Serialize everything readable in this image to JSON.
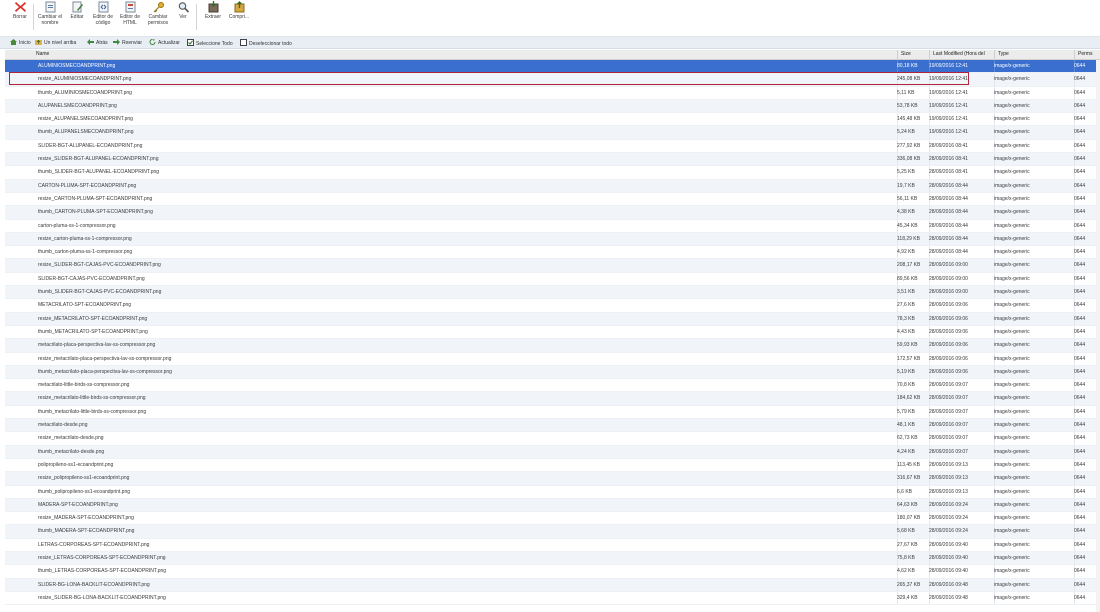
{
  "toolbar": {
    "items": [
      {
        "label": "Borrar",
        "icon": "delete-x-icon"
      },
      {
        "label": "Cambiar el nombre",
        "icon": "rename-icon"
      },
      {
        "label": "Editar",
        "icon": "edit-icon"
      },
      {
        "label": "Editor de código",
        "icon": "code-editor-icon"
      },
      {
        "label": "Editor de HTML",
        "icon": "html-editor-icon"
      },
      {
        "label": "Cambiar permisos",
        "icon": "key-icon"
      },
      {
        "label": "Ver",
        "icon": "magnifier-icon"
      },
      {
        "label": "Extraer",
        "icon": "extract-icon"
      },
      {
        "label": "Compri...",
        "icon": "compress-icon"
      }
    ]
  },
  "nav": {
    "items": [
      {
        "label": "Inicio",
        "icon": "home-icon"
      },
      {
        "label": "Un nivel arriba",
        "icon": "folder-up-icon"
      },
      {
        "label": "Atrás",
        "icon": "back-arrow-icon"
      },
      {
        "label": "Reenviar",
        "icon": "forward-arrow-icon"
      },
      {
        "label": "Actualizar",
        "icon": "refresh-icon"
      },
      {
        "label": "Seleccione Todo",
        "icon": "checkbox-checked-icon"
      },
      {
        "label": "Deseleccionar todo",
        "icon": "checkbox-empty-icon"
      }
    ]
  },
  "columns": {
    "name": "Name",
    "size": "Size",
    "modified": "Last Modified (Hora del",
    "type": "Type",
    "perms": "Perms"
  },
  "colors": {
    "selected_row": "#3a6fd0",
    "highlight_border": "#b0243a"
  },
  "files": [
    {
      "name": "ALUMINIOSMECOANDPRINT.png",
      "size": "80,18 KB",
      "modified": "19/09/2016 12:41",
      "type": "image/x-generic",
      "perms": "0644",
      "selected": true
    },
    {
      "name": "resize_ALUMINIOSMECOANDPRINT.png",
      "size": "245,08 KB",
      "modified": "19/09/2016 12:41",
      "type": "image/x-generic",
      "perms": "0644"
    },
    {
      "name": "thumb_ALUMINIOSMECOANDPRINT.png",
      "size": "5,11 KB",
      "modified": "19/09/2016 12:41",
      "type": "image/x-generic",
      "perms": "0644"
    },
    {
      "name": "ALUPANELSMECOANDPRINT.png",
      "size": "53,78 KB",
      "modified": "19/09/2016 12:41",
      "type": "image/x-generic",
      "perms": "0644"
    },
    {
      "name": "resize_ALUPANELSMECOANDPRINT.png",
      "size": "145,48 KB",
      "modified": "19/09/2016 12:41",
      "type": "image/x-generic",
      "perms": "0644"
    },
    {
      "name": "thumb_ALUPANELSMECOANDPRINT.png",
      "size": "5,24 KB",
      "modified": "19/09/2016 12:41",
      "type": "image/x-generic",
      "perms": "0644"
    },
    {
      "name": "SLIDER-BGT-ALUPANEL-ECOANDPRINT.png",
      "size": "277,92 KB",
      "modified": "28/09/2016 08:41",
      "type": "image/x-generic",
      "perms": "0644"
    },
    {
      "name": "resize_SLIDER-BGT-ALUPANEL-ECOANDPRINT.png",
      "size": "336,08 KB",
      "modified": "28/09/2016 08:41",
      "type": "image/x-generic",
      "perms": "0644"
    },
    {
      "name": "thumb_SLIDER-BGT-ALUPANEL-ECOANDPRINT.png",
      "size": "5,25 KB",
      "modified": "28/09/2016 08:41",
      "type": "image/x-generic",
      "perms": "0644"
    },
    {
      "name": "CARTON-PLUMA-SPT-ECOANDPRINT.png",
      "size": "19,7 KB",
      "modified": "28/09/2016 08:44",
      "type": "image/x-generic",
      "perms": "0644"
    },
    {
      "name": "resize_CARTON-PLUMA-SPT-ECOANDPRINT.png",
      "size": "56,11 KB",
      "modified": "28/09/2016 08:44",
      "type": "image/x-generic",
      "perms": "0644"
    },
    {
      "name": "thumb_CARTON-PLUMA-SPT-ECOANDPRINT.png",
      "size": "4,38 KB",
      "modified": "28/09/2016 08:44",
      "type": "image/x-generic",
      "perms": "0644"
    },
    {
      "name": "carton-pluma-ss-1-compressor.png",
      "size": "45,34 KB",
      "modified": "28/09/2016 08:44",
      "type": "image/x-generic",
      "perms": "0644"
    },
    {
      "name": "resize_carton-pluma-ss-1-compressor.png",
      "size": "118,29 KB",
      "modified": "28/09/2016 08:44",
      "type": "image/x-generic",
      "perms": "0644"
    },
    {
      "name": "thumb_carton-pluma-ss-1-compressor.png",
      "size": "4,92 KB",
      "modified": "28/09/2016 08:44",
      "type": "image/x-generic",
      "perms": "0644"
    },
    {
      "name": "resize_SLIDER-BGT-CAJAS-PVC-ECOANDPRINT.png",
      "size": "208,17 KB",
      "modified": "28/09/2016 09:00",
      "type": "image/x-generic",
      "perms": "0644"
    },
    {
      "name": "SLIDER-BGT-CAJAS-PVC-ECOANDPRINT.png",
      "size": "89,56 KB",
      "modified": "28/09/2016 09:00",
      "type": "image/x-generic",
      "perms": "0644"
    },
    {
      "name": "thumb_SLIDER-BGT-CAJAS-PVC-ECOANDPRINT.png",
      "size": "3,51 KB",
      "modified": "28/09/2016 09:00",
      "type": "image/x-generic",
      "perms": "0644"
    },
    {
      "name": "METACRILATO-SPT-ECOANDPRINT.png",
      "size": "27,6 KB",
      "modified": "28/09/2016 09:06",
      "type": "image/x-generic",
      "perms": "0644"
    },
    {
      "name": "resize_METACRILATO-SPT-ECOANDPRINT.png",
      "size": "78,3 KB",
      "modified": "28/09/2016 09:06",
      "type": "image/x-generic",
      "perms": "0644"
    },
    {
      "name": "thumb_METACRILATO-SPT-ECOANDPRINT.png",
      "size": "4,43 KB",
      "modified": "28/09/2016 09:06",
      "type": "image/x-generic",
      "perms": "0644"
    },
    {
      "name": "metacrilato-placa-perspectiva-lav-ss-compressor.png",
      "size": "59,93 KB",
      "modified": "28/09/2016 09:06",
      "type": "image/x-generic",
      "perms": "0644"
    },
    {
      "name": "resize_metacrilato-placa-perspectiva-lav-ss-compressor.png",
      "size": "172,57 KB",
      "modified": "28/09/2016 09:06",
      "type": "image/x-generic",
      "perms": "0644"
    },
    {
      "name": "thumb_metacrilato-placa-perspectiva-lav-ss-compressor.png",
      "size": "5,19 KB",
      "modified": "28/09/2016 09:06",
      "type": "image/x-generic",
      "perms": "0644"
    },
    {
      "name": "metacrilato-little-birds-ss-compressor.png",
      "size": "70,8 KB",
      "modified": "28/09/2016 09:07",
      "type": "image/x-generic",
      "perms": "0644"
    },
    {
      "name": "resize_metacrilato-little-birds-ss-compressor.png",
      "size": "184,62 KB",
      "modified": "28/09/2016 09:07",
      "type": "image/x-generic",
      "perms": "0644"
    },
    {
      "name": "thumb_metacrilato-little-birds-ss-compressor.png",
      "size": "5,79 KB",
      "modified": "28/09/2016 09:07",
      "type": "image/x-generic",
      "perms": "0644"
    },
    {
      "name": "metacrilato-desde.png",
      "size": "48,1 KB",
      "modified": "28/09/2016 09:07",
      "type": "image/x-generic",
      "perms": "0644"
    },
    {
      "name": "resize_metacrilato-desde.png",
      "size": "62,73 KB",
      "modified": "28/09/2016 09:07",
      "type": "image/x-generic",
      "perms": "0644"
    },
    {
      "name": "thumb_metacrilato-desde.png",
      "size": "4,24 KB",
      "modified": "28/09/2016 09:07",
      "type": "image/x-generic",
      "perms": "0644"
    },
    {
      "name": "polipropileno-ss1-ecoandprint.png",
      "size": "113,45 KB",
      "modified": "28/09/2016 09:13",
      "type": "image/x-generic",
      "perms": "0644"
    },
    {
      "name": "resize_polipropileno-ss1-ecoandprint.png",
      "size": "316,67 KB",
      "modified": "28/09/2016 09:13",
      "type": "image/x-generic",
      "perms": "0644"
    },
    {
      "name": "thumb_polipropileno-ss1-ecoandprint.png",
      "size": "6,6 KB",
      "modified": "28/09/2016 09:13",
      "type": "image/x-generic",
      "perms": "0644"
    },
    {
      "name": "MADERA-SPT-ECOANDPRINT.png",
      "size": "64,63 KB",
      "modified": "28/09/2016 09:24",
      "type": "image/x-generic",
      "perms": "0644"
    },
    {
      "name": "resize_MADERA-SPT-ECOANDPRINT.png",
      "size": "180,07 KB",
      "modified": "28/09/2016 09:24",
      "type": "image/x-generic",
      "perms": "0644"
    },
    {
      "name": "thumb_MADERA-SPT-ECOANDPRINT.png",
      "size": "5,68 KB",
      "modified": "28/09/2016 09:24",
      "type": "image/x-generic",
      "perms": "0644"
    },
    {
      "name": "LETRAS-CORPOREAS-SPT-ECOANDPRINT.png",
      "size": "27,67 KB",
      "modified": "28/09/2016 09:40",
      "type": "image/x-generic",
      "perms": "0644"
    },
    {
      "name": "resize_LETRAS-CORPOREAS-SPT-ECOANDPRINT.png",
      "size": "75,8 KB",
      "modified": "28/09/2016 09:40",
      "type": "image/x-generic",
      "perms": "0644"
    },
    {
      "name": "thumb_LETRAS-CORPOREAS-SPT-ECOANDPRINT.png",
      "size": "4,62 KB",
      "modified": "28/09/2016 09:40",
      "type": "image/x-generic",
      "perms": "0644"
    },
    {
      "name": "SLIDER-BG-LONA-BACKLIT-ECOANDPRINT.png",
      "size": "265,37 KB",
      "modified": "28/09/2016 09:48",
      "type": "image/x-generic",
      "perms": "0644"
    },
    {
      "name": "resize_SLIDER-BG-LONA-BACKLIT-ECOANDPRINT.png",
      "size": "329,4 KB",
      "modified": "28/09/2016 09:48",
      "type": "image/x-generic",
      "perms": "0644"
    }
  ]
}
